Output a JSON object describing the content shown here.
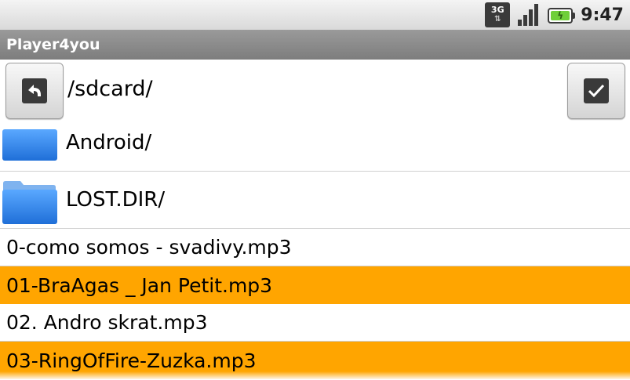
{
  "status_bar": {
    "network_label": "3G",
    "time": "9:47",
    "icons": [
      "network-3g-icon",
      "signal-strength-icon",
      "battery-charging-icon"
    ]
  },
  "title_bar": {
    "title": "Player4you"
  },
  "path_row": {
    "path": "/sdcard/",
    "back_icon": "back-arrow-icon",
    "confirm_icon": "checkmark-icon"
  },
  "folders": [
    {
      "name": "Android/",
      "icon": "folder-icon"
    },
    {
      "name": "LOST.DIR/",
      "icon": "folder-icon"
    }
  ],
  "files": [
    {
      "name": "0-como somos - svadivy.mp3"
    },
    {
      "name": "01-BraAgas _ Jan Petit.mp3"
    },
    {
      "name": "02. Andro skrat.mp3"
    },
    {
      "name": "03-RingOfFire-Zuzka.mp3"
    }
  ],
  "colors": {
    "highlight_row": "#ffa500",
    "title_bar": "#8a8a8a",
    "folder_blue": "#2f7fe0"
  }
}
